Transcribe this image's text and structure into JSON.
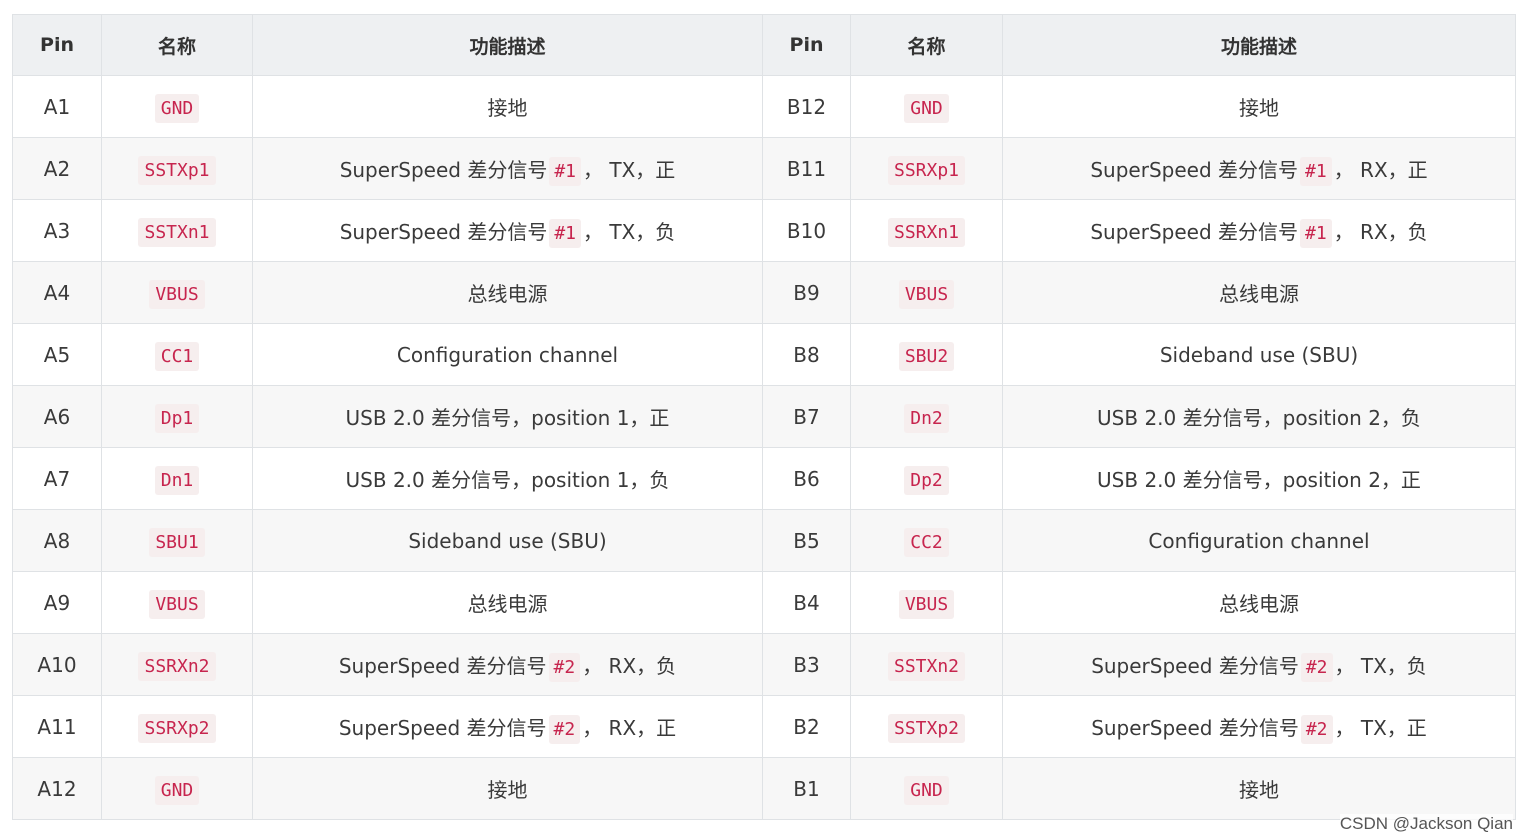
{
  "table": {
    "headers": [
      "Pin",
      "名称",
      "功能描述",
      "Pin",
      "名称",
      "功能描述"
    ],
    "rows": [
      {
        "pin_a": "A1",
        "name_a": "GND",
        "desc_a": {
          "pre": "接地",
          "code": "",
          "post": ""
        },
        "pin_b": "B12",
        "name_b": "GND",
        "desc_b": {
          "pre": "接地",
          "code": "",
          "post": ""
        }
      },
      {
        "pin_a": "A2",
        "name_a": "SSTXp1",
        "desc_a": {
          "pre": "SuperSpeed 差分信号",
          "code": "#1",
          "post": "， TX，正"
        },
        "pin_b": "B11",
        "name_b": "SSRXp1",
        "desc_b": {
          "pre": "SuperSpeed 差分信号",
          "code": "#1",
          "post": "， RX，正"
        }
      },
      {
        "pin_a": "A3",
        "name_a": "SSTXn1",
        "desc_a": {
          "pre": "SuperSpeed 差分信号",
          "code": "#1",
          "post": "， TX，负"
        },
        "pin_b": "B10",
        "name_b": "SSRXn1",
        "desc_b": {
          "pre": "SuperSpeed 差分信号",
          "code": "#1",
          "post": "， RX，负"
        }
      },
      {
        "pin_a": "A4",
        "name_a": "VBUS",
        "desc_a": {
          "pre": "总线电源",
          "code": "",
          "post": ""
        },
        "pin_b": "B9",
        "name_b": "VBUS",
        "desc_b": {
          "pre": "总线电源",
          "code": "",
          "post": ""
        }
      },
      {
        "pin_a": "A5",
        "name_a": "CC1",
        "desc_a": {
          "pre": "Configuration channel",
          "code": "",
          "post": ""
        },
        "pin_b": "B8",
        "name_b": "SBU2",
        "desc_b": {
          "pre": "Sideband use (SBU)",
          "code": "",
          "post": ""
        }
      },
      {
        "pin_a": "A6",
        "name_a": "Dp1",
        "desc_a": {
          "pre": "USB 2.0 差分信号，position 1，正",
          "code": "",
          "post": ""
        },
        "pin_b": "B7",
        "name_b": "Dn2",
        "desc_b": {
          "pre": "USB 2.0 差分信号，position 2，负",
          "code": "",
          "post": ""
        }
      },
      {
        "pin_a": "A7",
        "name_a": "Dn1",
        "desc_a": {
          "pre": "USB 2.0 差分信号，position 1，负",
          "code": "",
          "post": ""
        },
        "pin_b": "B6",
        "name_b": "Dp2",
        "desc_b": {
          "pre": "USB 2.0 差分信号，position 2，正",
          "code": "",
          "post": ""
        }
      },
      {
        "pin_a": "A8",
        "name_a": "SBU1",
        "desc_a": {
          "pre": "Sideband use (SBU)",
          "code": "",
          "post": ""
        },
        "pin_b": "B5",
        "name_b": "CC2",
        "desc_b": {
          "pre": "Configuration channel",
          "code": "",
          "post": ""
        }
      },
      {
        "pin_a": "A9",
        "name_a": "VBUS",
        "desc_a": {
          "pre": "总线电源",
          "code": "",
          "post": ""
        },
        "pin_b": "B4",
        "name_b": "VBUS",
        "desc_b": {
          "pre": "总线电源",
          "code": "",
          "post": ""
        }
      },
      {
        "pin_a": "A10",
        "name_a": "SSRXn2",
        "desc_a": {
          "pre": "SuperSpeed 差分信号",
          "code": "#2",
          "post": "， RX，负"
        },
        "pin_b": "B3",
        "name_b": "SSTXn2",
        "desc_b": {
          "pre": "SuperSpeed 差分信号",
          "code": "#2",
          "post": "， TX，负"
        }
      },
      {
        "pin_a": "A11",
        "name_a": "SSRXp2",
        "desc_a": {
          "pre": "SuperSpeed 差分信号",
          "code": "#2",
          "post": "， RX，正"
        },
        "pin_b": "B2",
        "name_b": "SSTXp2",
        "desc_b": {
          "pre": "SuperSpeed 差分信号",
          "code": "#2",
          "post": "， TX，正"
        }
      },
      {
        "pin_a": "A12",
        "name_a": "GND",
        "desc_a": {
          "pre": "接地",
          "code": "",
          "post": ""
        },
        "pin_b": "B1",
        "name_b": "GND",
        "desc_b": {
          "pre": "接地",
          "code": "",
          "post": ""
        }
      }
    ]
  },
  "watermark": "CSDN @Jackson Qian",
  "colors": {
    "code_text": "#c7254e",
    "code_bg": "#f6eeee",
    "header_bg": "#eef0f2",
    "stripe_bg": "#f7f7f7",
    "border": "#dfe2e5"
  }
}
